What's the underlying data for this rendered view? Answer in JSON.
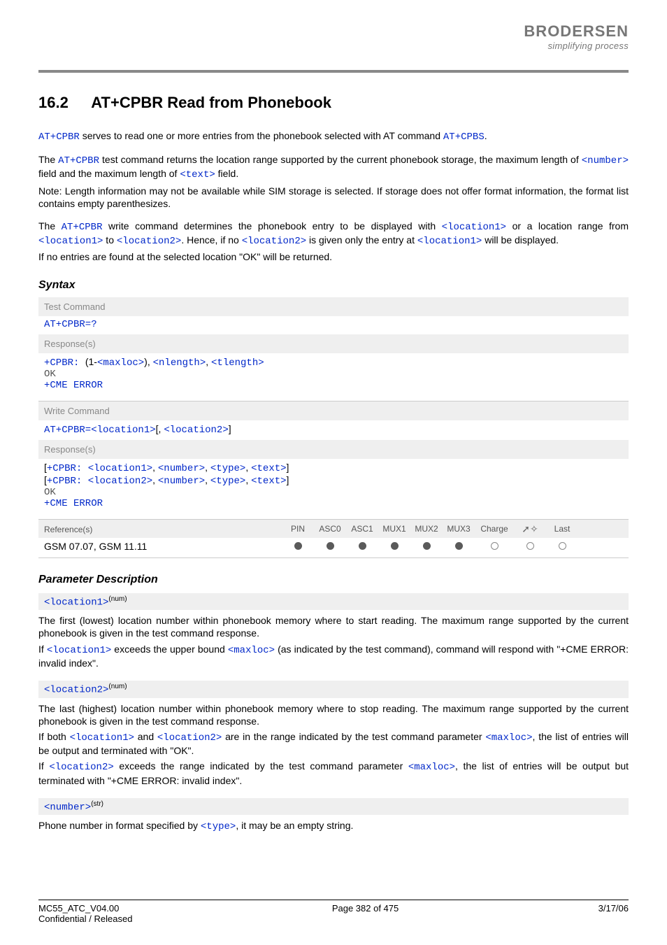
{
  "logo": {
    "text": "BRODERSEN",
    "tagline": "simplifying process"
  },
  "section": {
    "number": "16.2",
    "title": "AT+CPBR   Read from Phonebook"
  },
  "intro": {
    "p1a": "AT+CPBR",
    "p1b": " serves to read one or more entries from the phonebook selected with AT command ",
    "p1c": "AT+CPBS",
    "p1d": ".",
    "p2a": "The ",
    "p2b": "AT+CPBR",
    "p2c": " test command returns the location range supported by the current phonebook storage, the maximum length of ",
    "p2d": "<number>",
    "p2e": " field and the maximum length of ",
    "p2f": "<text>",
    "p2g": " field.",
    "p2h": "Note: Length information may not be available while SIM storage is selected. If storage does not offer format information, the format list contains empty parenthesizes.",
    "p3a": "The ",
    "p3b": "AT+CPBR",
    "p3c": " write command determines the phonebook entry to be displayed with ",
    "p3d": "<location1>",
    "p3e": " or a location range from ",
    "p3f": "<location1>",
    "p3g": " to ",
    "p3h": "<location2>",
    "p3i": ". Hence, if no ",
    "p3j": "<location2>",
    "p3k": " is given only the entry at ",
    "p3l": "<location1>",
    "p3m": " will be displayed.",
    "p3n": "If no entries are found at the selected location \"OK\" will be returned."
  },
  "syntax_heading": "Syntax",
  "test_cmd": {
    "label": "Test Command",
    "cmd": "AT+CPBR=?",
    "resp_label": "Response(s)",
    "r1a": "+CPBR: ",
    "r1b": "(1-",
    "r1c": "<maxloc>",
    "r1d": "), ",
    "r1e": "<nlength>",
    "r1f": ", ",
    "r1g": "<tlength>",
    "r2": "OK",
    "r3": "+CME ERROR"
  },
  "write_cmd": {
    "label": "Write Command",
    "c1": "AT+CPBR=",
    "c2": "<location1>",
    "c3": "[, ",
    "c4": "<location2>",
    "c5": "]",
    "resp_label": "Response(s)",
    "r1a": "[",
    "r1b": "+CPBR: ",
    "r1c": "<location1>",
    "r1d": ", ",
    "r1e": "<number>",
    "r1f": ", ",
    "r1g": "<type>",
    "r1h": ", ",
    "r1i": "<text>",
    "r1j": "]",
    "r2a": "[",
    "r2b": "+CPBR: ",
    "r2c": "<location2>",
    "r2d": ", ",
    "r2e": "<number>",
    "r2f": ", ",
    "r2g": "<type>",
    "r2h": ", ",
    "r2i": "<text>",
    "r2j": "]",
    "r3": "OK",
    "r4": "+CME ERROR"
  },
  "ref": {
    "label": "Reference(s)",
    "cols": [
      "PIN",
      "ASC0",
      "ASC1",
      "MUX1",
      "MUX2",
      "MUX3",
      "Charge",
      "",
      "Last"
    ],
    "value": "GSM 07.07, GSM 11.11",
    "dots": [
      "f",
      "f",
      "f",
      "f",
      "f",
      "f",
      "o",
      "o",
      "o"
    ]
  },
  "param_heading": "Parameter Description",
  "params": {
    "loc1": {
      "tag": "<location1>",
      "sup": "(num)",
      "b1": "The first (lowest) location number within phonebook memory where to start reading. The maximum range supported by the current phonebook is given in the test command response.",
      "b2a": "If ",
      "b2b": "<location1>",
      "b2c": " exceeds the upper bound ",
      "b2d": "<maxloc>",
      "b2e": " (as indicated by the test command), command will respond with \"+CME ERROR: invalid index\"."
    },
    "loc2": {
      "tag": "<location2>",
      "sup": "(num)",
      "b1": "The last (highest) location number within phonebook memory where to stop reading. The maximum range supported by the current phonebook is given in the test command response.",
      "b2a": "If both ",
      "b2b": "<location1>",
      "b2c": " and ",
      "b2d": "<location2>",
      "b2e": " are in the range indicated by the test command parameter ",
      "b2f": "<maxloc>",
      "b2g": ", the list of entries will be output and terminated with \"OK\".",
      "b3a": "If ",
      "b3b": "<location2>",
      "b3c": " exceeds the range indicated by the test command parameter ",
      "b3d": "<maxloc>",
      "b3e": ", the list of entries will be output but terminated with \"+CME ERROR: invalid index\"."
    },
    "num": {
      "tag": "<number>",
      "sup": "(str)",
      "b1a": "Phone number in format specified by ",
      "b1b": "<type>",
      "b1c": ", it may be an empty string."
    }
  },
  "footer": {
    "l1": "MC55_ATC_V04.00",
    "l2": "Confidential / Released",
    "mid": "Page 382 of 475",
    "right": "3/17/06"
  }
}
